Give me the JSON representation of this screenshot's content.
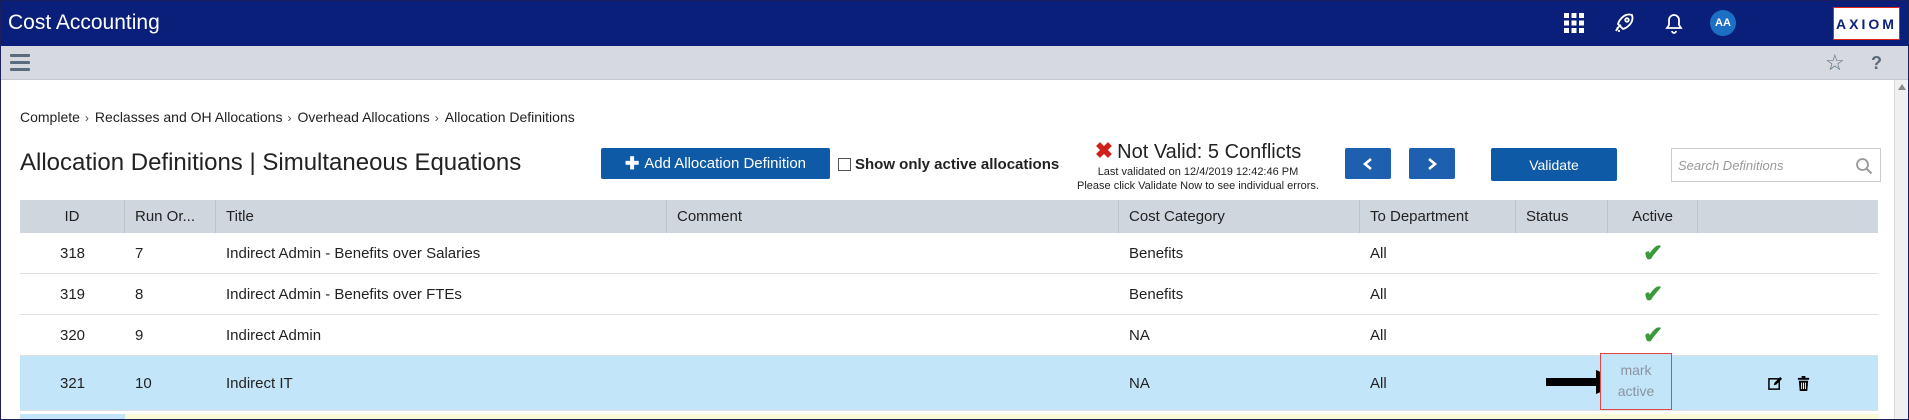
{
  "app": {
    "title": "Cost Accounting",
    "user_initials": "AA",
    "logo_text": "AXIOM"
  },
  "topbar_icons": [
    "apps-grid-icon",
    "rocket-icon",
    "bell-icon"
  ],
  "breadcrumb": [
    {
      "label": "Complete"
    },
    {
      "label": "Reclasses and OH Allocations"
    },
    {
      "label": "Overhead Allocations"
    },
    {
      "label": "Allocation Definitions"
    }
  ],
  "page": {
    "title": "Allocation Definitions | Simultaneous Equations",
    "add_button": "Add Allocation Definition",
    "show_active_label": "Show only active allocations",
    "validate_button": "Validate",
    "search_placeholder": "Search Definitions"
  },
  "validation": {
    "status": "Not Valid: 5 Conflicts",
    "last_validated": "Last validated on 12/4/2019 12:42:46 PM",
    "hint": "Please click Validate Now to see individual errors.",
    "error_color": "#d0201a"
  },
  "table": {
    "columns": [
      "ID",
      "Run Or...",
      "Title",
      "Comment",
      "Cost Category",
      "To Department",
      "Status",
      "Active"
    ],
    "rows": [
      {
        "id": "318",
        "run_order": "7",
        "title": "Indirect Admin - Benefits over Salaries",
        "comment": "",
        "cost_category": "Benefits",
        "to_department": "All",
        "status": "",
        "active": true
      },
      {
        "id": "319",
        "run_order": "8",
        "title": "Indirect Admin - Benefits over FTEs",
        "comment": "",
        "cost_category": "Benefits",
        "to_department": "All",
        "status": "",
        "active": true
      },
      {
        "id": "320",
        "run_order": "9",
        "title": "Indirect Admin",
        "comment": "",
        "cost_category": "NA",
        "to_department": "All",
        "status": "",
        "active": true
      },
      {
        "id": "321",
        "run_order": "10",
        "title": "Indirect IT",
        "comment": "",
        "cost_category": "NA",
        "to_department": "All",
        "status": "",
        "active": false,
        "mark_active_label_1": "mark",
        "mark_active_label_2": "active"
      }
    ]
  },
  "colors": {
    "topbar": "#0a1f7a",
    "primary_button": "#0e5aa7",
    "selected_row": "#c3e5fa",
    "active_check": "#3a9a3a"
  }
}
